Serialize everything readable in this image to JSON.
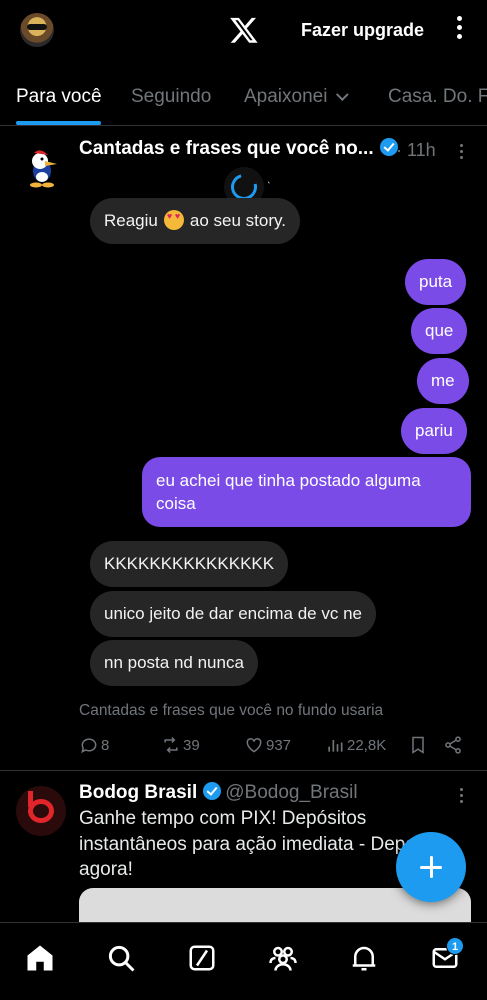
{
  "header": {
    "upgrade_label": "Fazer upgrade",
    "icons": [
      "avatar",
      "x-logo",
      "more-icon"
    ]
  },
  "tabs": [
    {
      "label": "Para você",
      "active": true
    },
    {
      "label": "Seguindo",
      "active": false
    },
    {
      "label": "Apaixonei",
      "active": false,
      "has_dropdown": true
    },
    {
      "label": "Casa. Do. Fi",
      "active": false
    }
  ],
  "post1": {
    "author": "Cantadas e frases que você no...",
    "verified": true,
    "time": "· 11h",
    "chat": {
      "reaction": {
        "before": "Reagiu",
        "emoji": "heart-eyes",
        "after": "ao seu story."
      },
      "outgoing": [
        "puta",
        "que",
        "me",
        "pariu",
        "eu achei que tinha postado alguma coisa"
      ],
      "incoming": [
        "KKKKKKKKKKKKKKK",
        "unico jeito de dar encima de vc ne",
        "nn posta nd nunca"
      ]
    },
    "caption": "Cantadas e frases que você no fundo usaria",
    "stats": {
      "replies": "8",
      "reposts": "39",
      "likes": "937",
      "views": "22,8K"
    }
  },
  "post2": {
    "author": "Bodog Brasil",
    "verified": true,
    "handle": "@Bodog_Brasil",
    "text": "Ganhe tempo com PIX! Depósitos instantâneos para ação imediata - Deposite agora!"
  },
  "bottom_nav": {
    "items": [
      "home-icon",
      "search-icon",
      "grok-icon",
      "communities-icon",
      "notifications-icon",
      "messages-icon"
    ],
    "messages_badge": "1"
  },
  "colors": {
    "accent": "#1d9bf0",
    "outgoing_bubble": "#7b4be8",
    "incoming_bubble": "#262626",
    "muted": "#71767b"
  }
}
